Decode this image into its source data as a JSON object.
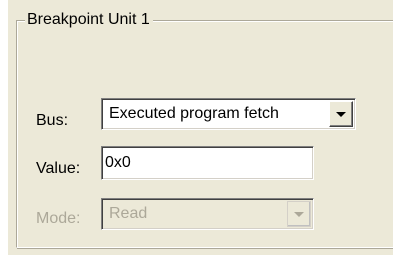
{
  "group": {
    "title": "Breakpoint Unit 1"
  },
  "bus": {
    "label": "Bus:",
    "value": "Executed program fetch",
    "icon": "chevron-down-icon"
  },
  "value": {
    "label": "Value:",
    "text": "0x0"
  },
  "mode": {
    "label": "Mode:",
    "value": "Read",
    "disabled": true,
    "icon": "chevron-down-icon"
  }
}
